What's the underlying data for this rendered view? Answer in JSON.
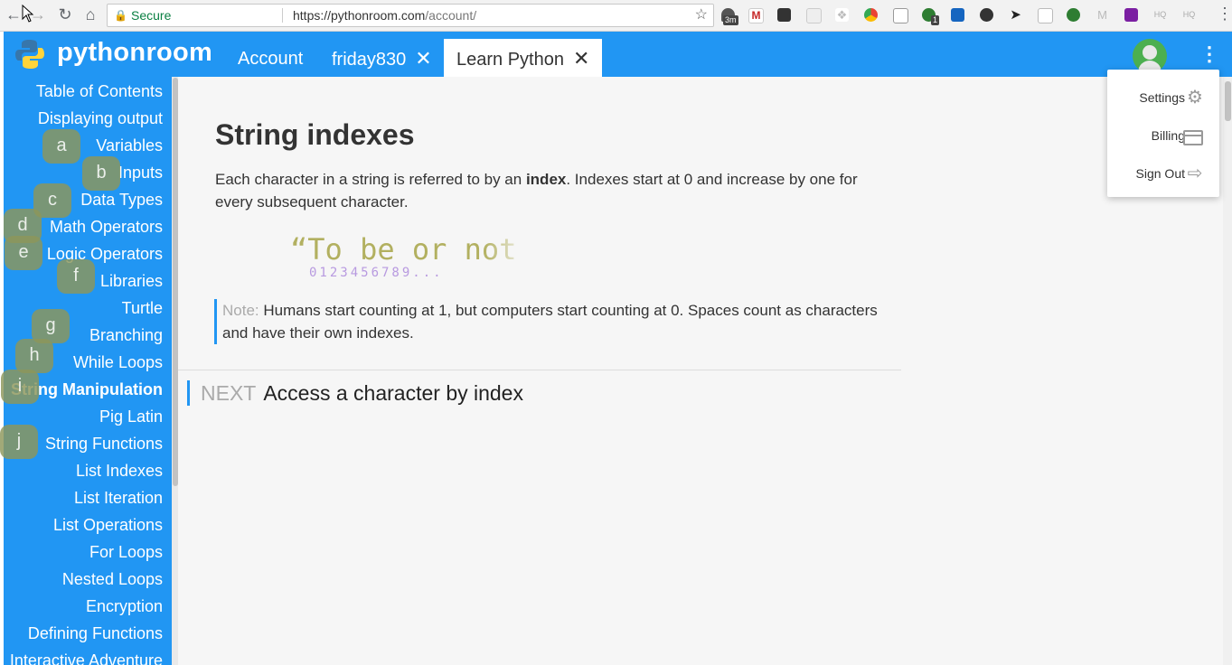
{
  "browser": {
    "secure_label": "Secure",
    "url_host": "https://pythonroom.com",
    "url_path": "/account/",
    "extension_badges": [
      "3m",
      "1"
    ]
  },
  "header": {
    "app_name": "pythonroom",
    "tabs": [
      {
        "label": "Account",
        "closable": false
      },
      {
        "label": "friday830",
        "closable": true
      },
      {
        "label": "Learn Python",
        "closable": true,
        "active": true
      }
    ]
  },
  "sidebar": {
    "items": [
      {
        "label": "Table of Contents"
      },
      {
        "label": "Displaying output"
      },
      {
        "label": "Variables"
      },
      {
        "label": "Inputs"
      },
      {
        "label": "Data Types"
      },
      {
        "label": "Math Operators"
      },
      {
        "label": "Logic Operators"
      },
      {
        "label": "Libraries"
      },
      {
        "label": "Turtle"
      },
      {
        "label": "Branching"
      },
      {
        "label": "While Loops"
      },
      {
        "label": "String Manipulation",
        "active": true
      },
      {
        "label": "Pig Latin"
      },
      {
        "label": "String Functions"
      },
      {
        "label": "List Indexes"
      },
      {
        "label": "List Iteration"
      },
      {
        "label": "List Operations"
      },
      {
        "label": "For Loops"
      },
      {
        "label": "Nested Loops"
      },
      {
        "label": "Encryption"
      },
      {
        "label": "Defining Functions"
      },
      {
        "label": "Interactive Adventure"
      }
    ]
  },
  "hints": [
    "a",
    "b",
    "c",
    "d",
    "e",
    "f",
    "g",
    "h",
    "i",
    "j"
  ],
  "content": {
    "title": "String indexes",
    "para_before": "Each character in a string is referred to by an ",
    "para_bold": "index",
    "para_after": ". Indexes start at 0 and increase by one for every subsequent character.",
    "quote_text": "“To be or not t",
    "index_digits": "0123456789...",
    "note_label": "Note:",
    "note_text": " Humans start counting at 1, but computers start counting at 0. Spaces count as characters and have their own indexes.",
    "next_label": "NEXT",
    "next_title": "Access a character by index"
  },
  "dropdown": {
    "items": [
      {
        "label": "Settings",
        "icon": "gear-icon"
      },
      {
        "label": "Billing",
        "icon": "credit-card-icon"
      },
      {
        "label": "Sign Out",
        "icon": "sign-out-icon"
      }
    ]
  },
  "colors": {
    "brand_blue": "#2196f3",
    "hint_bubble": "#8c965a"
  }
}
